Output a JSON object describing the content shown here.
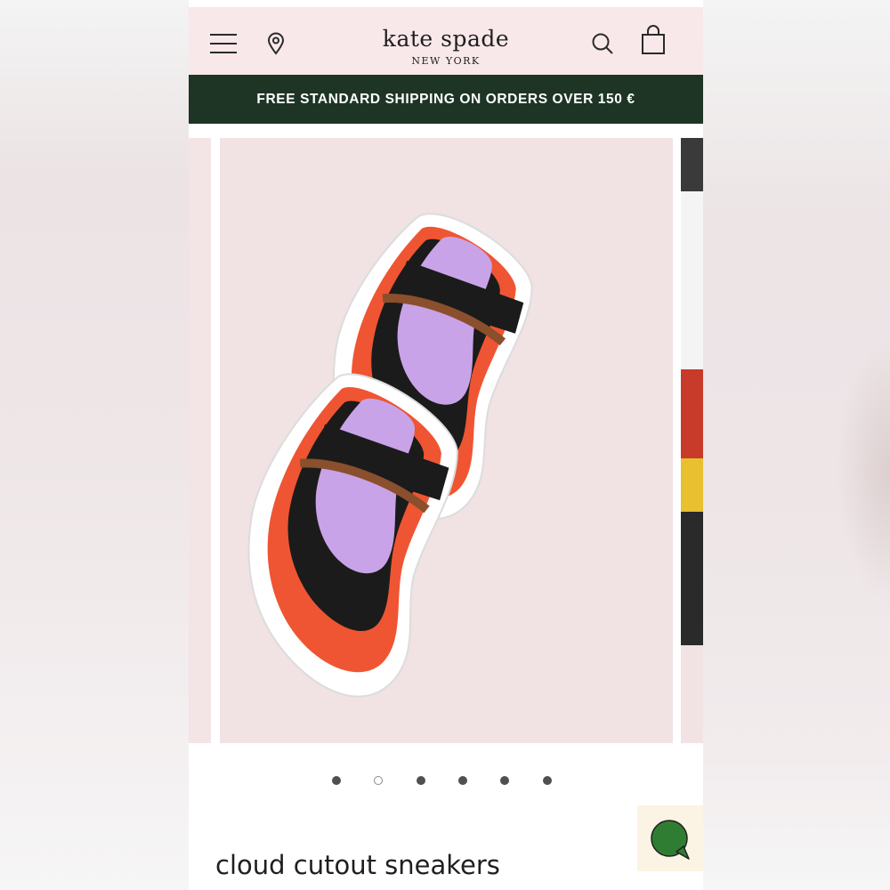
{
  "header": {
    "brand": "kate spade",
    "brand_sub": "NEW YORK",
    "icons": [
      "menu-icon",
      "location-pin-icon",
      "search-icon",
      "shopping-bag-icon"
    ]
  },
  "promo": {
    "text": "FREE STANDARD SHIPPING ON ORDERS OVER 150 €"
  },
  "carousel": {
    "slide_count": 6,
    "active_index": 1
  },
  "product": {
    "title": "cloud cutout sneakers"
  },
  "chat": {
    "icon": "chat-bubble-icon"
  },
  "colors": {
    "header_bg": "#f9e8ea",
    "promo_bg": "#1e3526",
    "slide_bg": "#f1e2e4",
    "chat_accent": "#2f7d33"
  }
}
